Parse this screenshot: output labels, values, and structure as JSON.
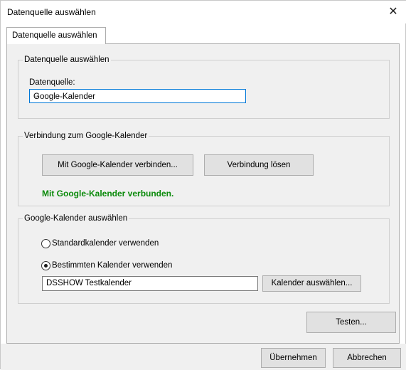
{
  "window": {
    "title": "Datenquelle auswählen",
    "close_glyph": "✕"
  },
  "tab": {
    "label": "Datenquelle auswählen"
  },
  "group_source": {
    "legend": "Datenquelle auswählen",
    "field_label": "Datenquelle:",
    "selected": "Google-Kalender",
    "chevron": "⌵"
  },
  "group_connection": {
    "legend": "Verbindung zum Google-Kalender",
    "connect_label": "Mit Google-Kalender verbinden...",
    "disconnect_label": "Verbindung lösen",
    "status": "Mit Google-Kalender verbunden.",
    "status_color": "#0a8a0a"
  },
  "group_calendar": {
    "legend": "Google-Kalender auswählen",
    "option_default": "Standardkalender verwenden",
    "option_specific": "Bestimmten Kalender verwenden",
    "selected_option": "specific",
    "calendar_value": "DSSHOW Testkalender",
    "choose_label": "Kalender auswählen..."
  },
  "test_label": "Testen...",
  "footer": {
    "apply_label": "Übernehmen",
    "cancel_label": "Abbrechen"
  },
  "colors": {
    "accent": "#0078d7",
    "panel_bg": "#f0f0f0",
    "button_bg": "#e1e1e1"
  }
}
